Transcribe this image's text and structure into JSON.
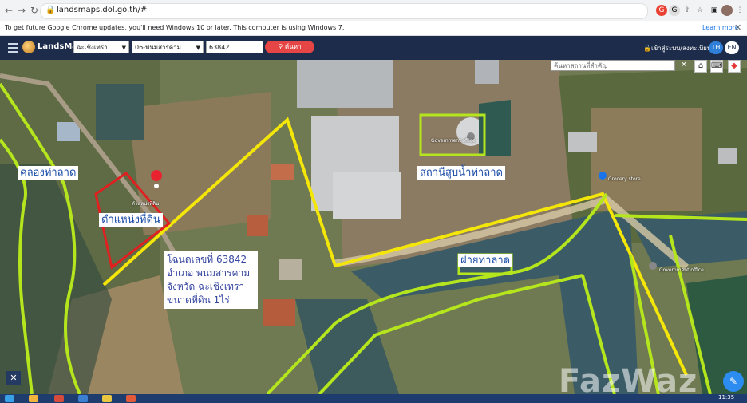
{
  "browser": {
    "url": "landsmaps.dol.go.th/#",
    "update_message": "To get future Google Chrome updates, you'll need Windows 10 or later. This computer is using Windows 7.",
    "learn_more": "Learn more",
    "close": "✕"
  },
  "app": {
    "brand": "LandsMaps",
    "province": "ฉะเชิงเทรา",
    "district": "06-พนมสารคาม",
    "parcel_number": "63842",
    "search_label": "ค้นหา",
    "login_label": "เข้าสู่ระบบ/ลงทะเบียน",
    "lang_th": "TH",
    "lang_en": "EN"
  },
  "map": {
    "place_search_placeholder": "ค้นหาสถานที่สำคัญ",
    "labels": {
      "canal": "คลองท่าลาด",
      "plot_position": "ตำแหน่งที่ดิน",
      "pump_station": "สถานีสูบน้ำท่าลาด",
      "weir": "ฝายท่าลาด"
    },
    "info": {
      "line1": "โฉนดเลขที่ 63842",
      "line2": "อำเภอ พนมสารคาม",
      "line3": "จังหวัด ฉะเชิงเทรา",
      "line4": "ขนาดที่ดิน 1ไร่"
    },
    "map_text": {
      "plot_pin": "ตำแหน่งที่ดิน",
      "gov_office_1": "Government office",
      "grocery": "Grocery store",
      "gov_office_2": "Government office"
    },
    "watermark": "FazWaz"
  },
  "taskbar": {
    "clock": "11:35"
  },
  "colors": {
    "header": "#1c2c4a",
    "highlight_green": "#b5e61d",
    "road_yellow": "#f5e60a",
    "plot_red": "#e02020"
  }
}
